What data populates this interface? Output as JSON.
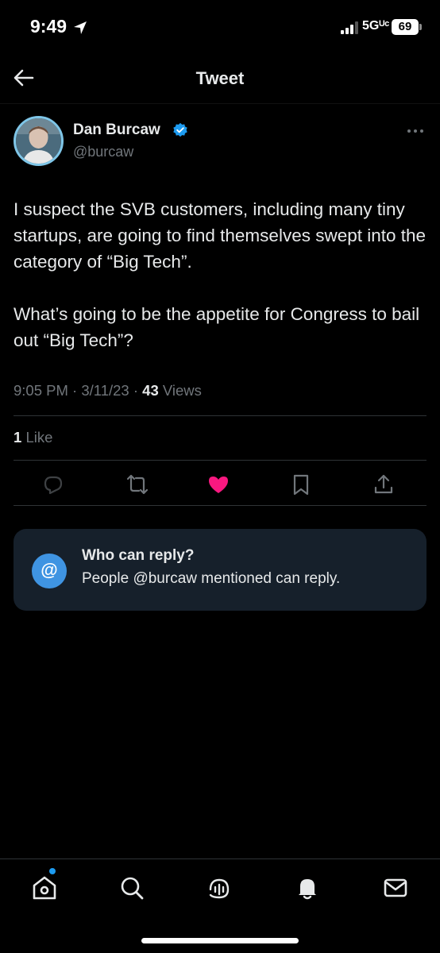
{
  "status_bar": {
    "time": "9:49",
    "network": "5Gᵁᶜ",
    "battery": "69"
  },
  "header": {
    "title": "Tweet"
  },
  "tweet": {
    "author_name": "Dan Burcaw",
    "author_handle": "@burcaw",
    "text": "I suspect the SVB customers, including many tiny startups, are going to find themselves swept into the category of “Big Tech”.\n\nWhat’s going to be the appetite for Congress to bail out “Big Tech”?",
    "time": "9:05 PM",
    "date": "3/11/23",
    "views_count": "43",
    "views_label": "Views",
    "likes_count": "1",
    "likes_label": "Like"
  },
  "reply_settings": {
    "title": "Who can reply?",
    "description": "People @burcaw mentioned can reply.",
    "icon_text": "@"
  },
  "colors": {
    "accent": "#1d9bf0",
    "like": "#f91880",
    "card": "#16202b",
    "muted": "#71767b"
  },
  "tab_bar": {
    "items": [
      "home-icon",
      "search-icon",
      "spaces-icon",
      "notifications-icon",
      "messages-icon"
    ]
  }
}
